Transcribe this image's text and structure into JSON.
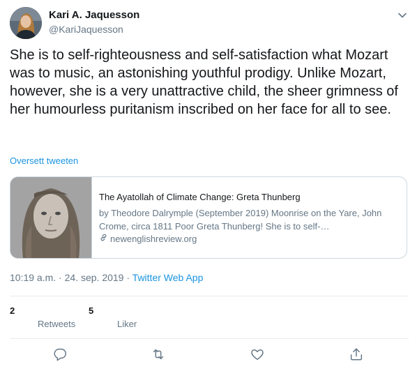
{
  "author": {
    "name": "Kari A. Jaquesson",
    "handle": "@KariJaquesson"
  },
  "tweet": {
    "text": "She is to self-righteousness and self-satisfaction what Mozart was to music, an astonishing youthful prodigy. Unlike Mozart, however, she is a very unattractive child, the sheer grimness of her humourless puritanism inscribed on her face for all to see.",
    "translate_label": "Oversett tweeten"
  },
  "card": {
    "title": "The Ayatollah of Climate Change: Greta Thunberg",
    "description": "by Theodore Dalrymple (September 2019)    Moonrise on the Yare, John Crome, circa 1811      Poor Greta Thunberg! She is to self-…",
    "domain": "newenglishreview.org"
  },
  "meta": {
    "time": "10:19 a.m.",
    "sep": " · ",
    "date": "24. sep. 2019",
    "sep2": " · ",
    "app": "Twitter Web App"
  },
  "stats": {
    "retweets_count": "2",
    "retweets_label": "Retweets",
    "likes_count": "5",
    "likes_label": "Liker"
  },
  "icons": {
    "caret": "chevron-down-icon",
    "reply": "reply-icon",
    "retweet": "retweet-icon",
    "like": "heart-icon",
    "share": "share-icon",
    "link": "link-icon"
  },
  "colors": {
    "accent": "#1b95e0",
    "text": "#14171a",
    "secondary": "#657786",
    "border": "#ccd6dd"
  }
}
